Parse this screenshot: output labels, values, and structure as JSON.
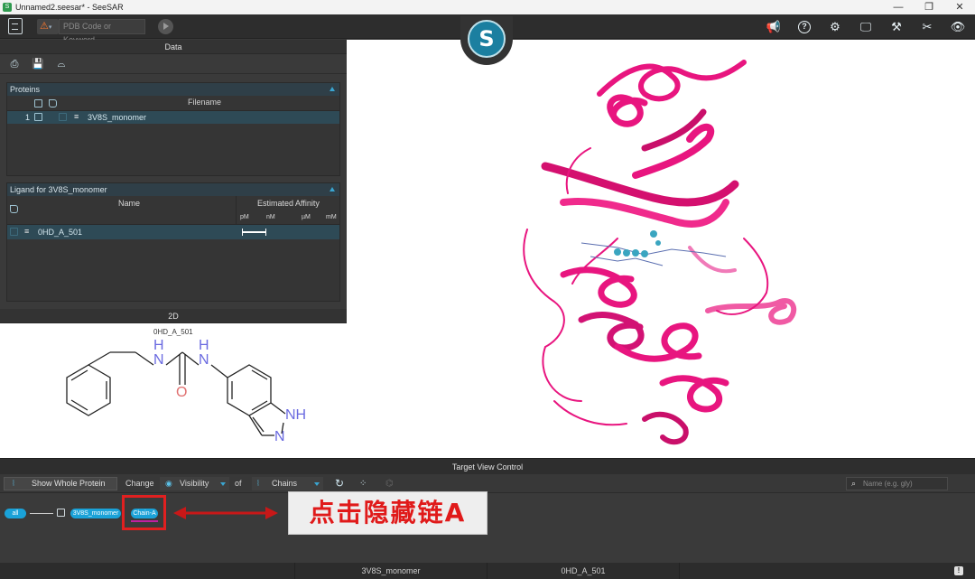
{
  "window": {
    "title": "Unnamed2.seesar* - SeeSAR",
    "controls": [
      "—",
      "❐",
      "✕"
    ]
  },
  "toolbar": {
    "search_placeholder": "PDB Code or Keyword",
    "right_icons": [
      "megaphone-icon",
      "help-icon",
      "settings-icon",
      "monitor-icon",
      "tools-icon",
      "tools-alt-icon",
      "eye-icon"
    ]
  },
  "data_panel": {
    "title": "Data",
    "proteins": {
      "title": "Proteins",
      "column_filename": "Filename",
      "rows": [
        {
          "index": "1",
          "filename": "3V8S_monomer"
        }
      ]
    },
    "ligands": {
      "title": "Ligand for 3V8S_monomer",
      "column_name": "Name",
      "column_affinity": "Estimated Affinity",
      "affinity_units": [
        "pM",
        "nM",
        "µM",
        "mM"
      ],
      "rows": [
        {
          "name": "0HD_A_501"
        }
      ]
    }
  },
  "twod_panel": {
    "title": "2D",
    "ligand_label": "0HD_A_501",
    "atom_labels": {
      "nh1_h": "H",
      "nh1_n": "N",
      "nh2_h": "H",
      "nh2_n": "N",
      "o": "O",
      "ring_nh": "NH",
      "ring_n": "N"
    }
  },
  "target_view": {
    "title": "Target View Control",
    "show_whole_label": "Show Whole Protein",
    "change_label": "Change",
    "visibility_label": "Visibility",
    "of_label": "of",
    "chains_label": "Chains",
    "name_search_placeholder": "Name (e.g. gly)",
    "tree": {
      "all": "all",
      "protein": "3V8S_monomer",
      "chain": "Chain-A"
    }
  },
  "annotation": {
    "callout_text": "点击隐藏链A"
  },
  "statusbar": {
    "protein": "3V8S_monomer",
    "ligand": "0HD_A_501"
  },
  "colors": {
    "accent": "#1aa2d8",
    "protein_ribbon": "#e8157f",
    "annotation_red": "#e01a1a"
  }
}
